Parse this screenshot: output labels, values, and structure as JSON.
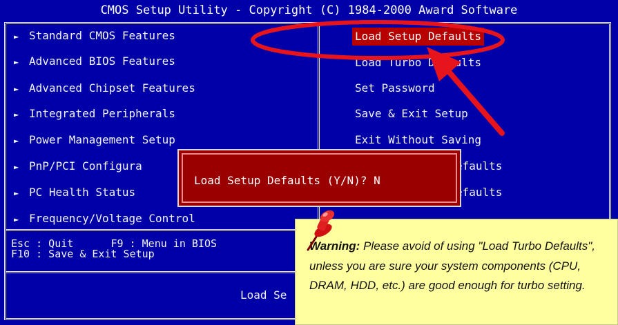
{
  "title": "CMOS Setup Utility - Copyright (C) 1984-2000 Award Software",
  "left_menu": [
    {
      "label": "Standard CMOS Features"
    },
    {
      "label": "Advanced BIOS Features"
    },
    {
      "label": "Advanced Chipset Features"
    },
    {
      "label": "Integrated Peripherals"
    },
    {
      "label": "Power Management Setup"
    },
    {
      "label": "PnP/PCI Configura"
    },
    {
      "label": "PC Health Status"
    },
    {
      "label": "Frequency/Voltage Control"
    }
  ],
  "right_menu": [
    {
      "label": "Load Setup Defaults",
      "selected": true
    },
    {
      "label": "Load Turbo Defaults"
    },
    {
      "label": "Set Password"
    },
    {
      "label": "Save & Exit Setup"
    },
    {
      "label": "Exit Without Saving"
    },
    {
      "label": "efaults"
    },
    {
      "label": "efaults"
    }
  ],
  "status": {
    "line1": "Esc : Quit      F9 : Menu in BIOS",
    "line2": "F10 : Save & Exit Setup"
  },
  "bottom_text": "Load Se",
  "dialog": {
    "text": "Load Setup Defaults (Y/N)? N"
  },
  "note": {
    "bold": "Warning:",
    "text": " Please avoid of using \"Load Turbo Defaults\", unless you are sure your system components (CPU, DRAM, HDD, etc.) are good enough for turbo setting."
  },
  "colors": {
    "bios_background": "#0000a8",
    "highlight": "#b80000",
    "dialog": "#9a0000",
    "note_background": "#ffffa0",
    "annotation": "#e8141c"
  },
  "icons": [
    "menu-arrow-icon",
    "push-pin-icon",
    "annotation-arrow-icon",
    "annotation-ellipse-icon"
  ]
}
